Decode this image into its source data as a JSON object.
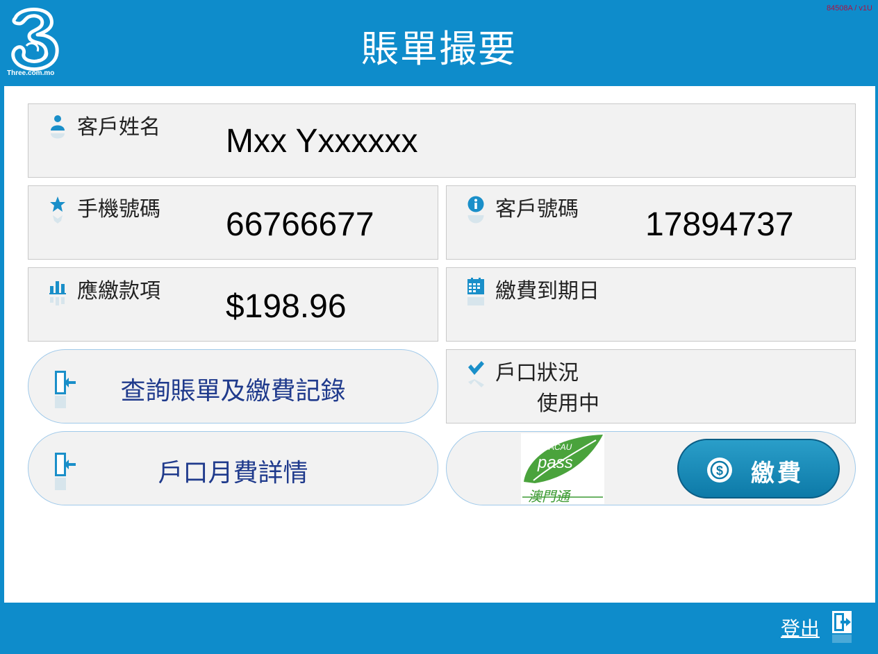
{
  "header": {
    "logo_text": "Three.com.mo",
    "version": "84508A / v1U",
    "title": "賬單撮要"
  },
  "customer_name": {
    "label": "客戶姓名",
    "value": "Mxx Yxxxxxx",
    "icon": "user-icon"
  },
  "phone_number": {
    "label": "手機號碼",
    "value": "66766677",
    "icon": "star-icon"
  },
  "account_number": {
    "label": "客戶號碼",
    "value": "17894737",
    "icon": "info-icon"
  },
  "amount_due": {
    "label": "應繳款項",
    "value": "$198.96",
    "icon": "bar-chart-icon"
  },
  "due_date": {
    "label": "繳費到期日",
    "value": "",
    "icon": "calendar-icon"
  },
  "account_status": {
    "label": "戶口狀況",
    "value": "使用中",
    "icon": "check-icon"
  },
  "actions": {
    "bill_history": "查詢賬單及繳費記錄",
    "monthly_fee": "戶口月費詳情",
    "pay_button": "繳費"
  },
  "macau_pass": {
    "brand": "MACAU pass",
    "chinese": "澳門通"
  },
  "footer": {
    "logout": "登出"
  },
  "colors": {
    "brand_blue": "#0e8ccb",
    "pill_text": "#1f3a8c",
    "icon_blue": "#1a8fc9"
  }
}
